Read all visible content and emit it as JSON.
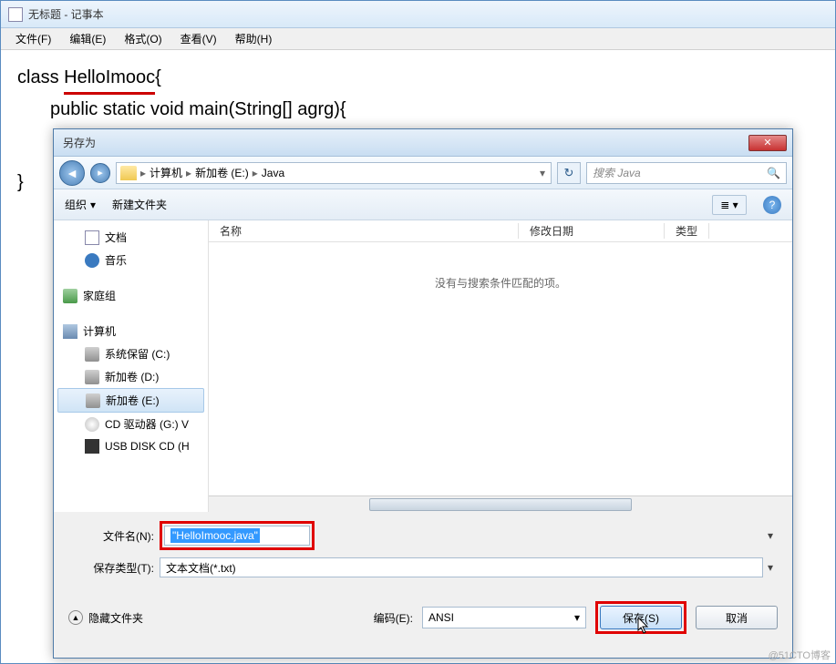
{
  "notepad": {
    "title": "无标题 - 记事本",
    "menu": {
      "file": "文件(F)",
      "edit": "编辑(E)",
      "format": "格式(O)",
      "view": "查看(V)",
      "help": "帮助(H)"
    },
    "code": {
      "line1_pre": "class ",
      "line1_name": "HelloImooc",
      "line1_post": "{",
      "line2": "public static void main(String[] agrg){",
      "brace": "}"
    }
  },
  "dialog": {
    "title": "另存为",
    "close": "✕",
    "nav": {
      "path": {
        "p1": "计算机",
        "p2": "新加卷 (E:)",
        "p3": "Java"
      },
      "search_placeholder": "搜索 Java"
    },
    "toolbar": {
      "organize": "组织",
      "newfolder": "新建文件夹"
    },
    "sidebar": {
      "docs": "文档",
      "music": "音乐",
      "homegroup": "家庭组",
      "computer": "计算机",
      "sysres": "系统保留 (C:)",
      "d": "新加卷 (D:)",
      "e": "新加卷 (E:)",
      "cd": "CD 驱动器 (G:) V",
      "usb": "USB DISK CD (H"
    },
    "filelist": {
      "col_name": "名称",
      "col_date": "修改日期",
      "col_type": "类型",
      "empty": "没有与搜索条件匹配的项。"
    },
    "fields": {
      "filename_label": "文件名(N):",
      "filename_value": "\"HelloImooc.java\"",
      "filetype_label": "保存类型(T):",
      "filetype_value": "文本文档(*.txt)"
    },
    "footer": {
      "hide": "隐藏文件夹",
      "encoding_label": "编码(E):",
      "encoding_value": "ANSI",
      "save": "保存(S)",
      "cancel": "取消"
    }
  },
  "watermark": "@51CTO博客"
}
